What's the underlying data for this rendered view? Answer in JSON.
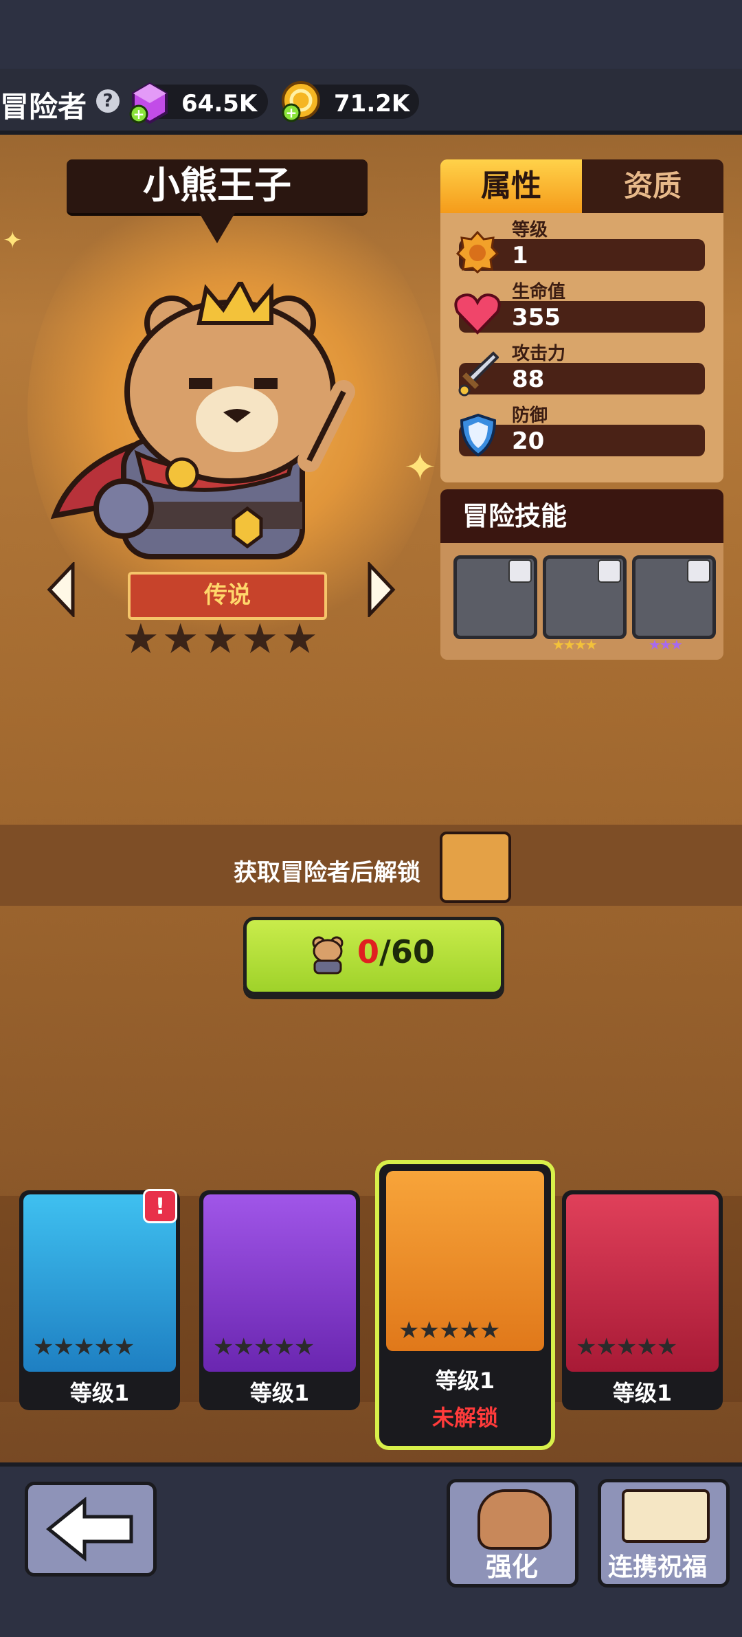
{
  "header": {
    "title": "冒险者",
    "gems": "64.5K",
    "coins": "71.2K"
  },
  "hero": {
    "name": "小熊王子",
    "rarity": "传说",
    "stars": "★★★★★"
  },
  "tabs": {
    "attributes": "属性",
    "aptitude": "资质"
  },
  "stats": [
    {
      "label": "等级",
      "value": "1"
    },
    {
      "label": "生命值",
      "value": "355"
    },
    {
      "label": "攻击力",
      "value": "88"
    },
    {
      "label": "防御",
      "value": "20"
    }
  ],
  "skills": {
    "title": "冒险技能",
    "items": [
      {
        "stars": ""
      },
      {
        "stars": "★★★★"
      },
      {
        "stars": "★★★"
      }
    ]
  },
  "unlock": {
    "text": "获取冒险者后解锁",
    "current": "0",
    "required": "/60"
  },
  "cards": [
    {
      "level": "等级1",
      "status": "",
      "color": "#2aa6d8",
      "stars": "★★★★★"
    },
    {
      "level": "等级1",
      "status": "",
      "color": "#8a3fd0",
      "stars": "★★★★★"
    },
    {
      "level": "等级1",
      "status": "未解锁",
      "color": "#f28a1e",
      "stars": "★★★★★"
    },
    {
      "level": "等级1",
      "status": "",
      "color": "#d8304a",
      "stars": "★★★★★"
    }
  ],
  "bottom": {
    "upgrade": "强化",
    "blessing": "连携祝福"
  },
  "colors": {
    "accent_green": "#b6e23a",
    "locked_red": "#ff3b3b",
    "panel_dark": "#3a1c12"
  }
}
